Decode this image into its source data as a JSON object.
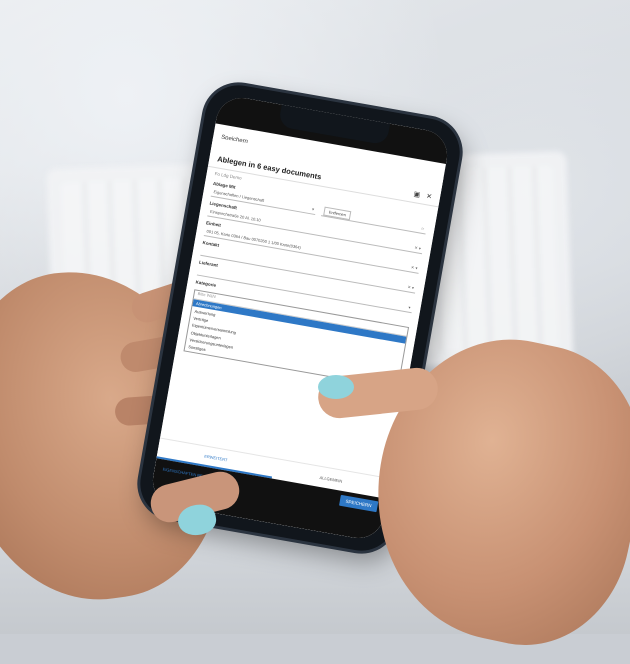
{
  "screen": {
    "header_title": "Speichern",
    "dialog_title": "Ablegen in 6 easy documents",
    "subtitle": "Fo Ldg Demo",
    "fields": {
      "ablage_label": "Ablage Mit",
      "ablage_value": "Eigenschaften / Liegenschaft",
      "entfernen_label": "Entfernen",
      "liegenschaft_label": "Liegenschaft",
      "liegenschaft_value": "Einsprechstraße 20 Al. 10.10",
      "einheit_label": "Einheit",
      "einheit_value": "001 05, Karte 0364 / Bau 0070260 1 1/00 Karte(0364)",
      "kontakt_label": "Kontakt",
      "lieferant_label": "Lieferant",
      "kategorie_label": "Kategorie",
      "kategorie_placeholder": "Bitte Wähl"
    },
    "dropdown_items": [
      "Abrechnungen",
      "Auswertung",
      "Verträge",
      "Eigentümerversammlung",
      "Objektunterlagen",
      "Versicherungsunterlagen",
      "Sonstiges"
    ],
    "selected_index": 0,
    "tabs": {
      "tab1": "ERWEITERT",
      "tab2": "EIGENSCHAFTEN BEARBEITEN",
      "tab3": "ALLGEMEIN"
    },
    "save_button": "SPEICHERN"
  },
  "colors": {
    "accent": "#2e78c6",
    "nail": "#8fd3dc"
  }
}
